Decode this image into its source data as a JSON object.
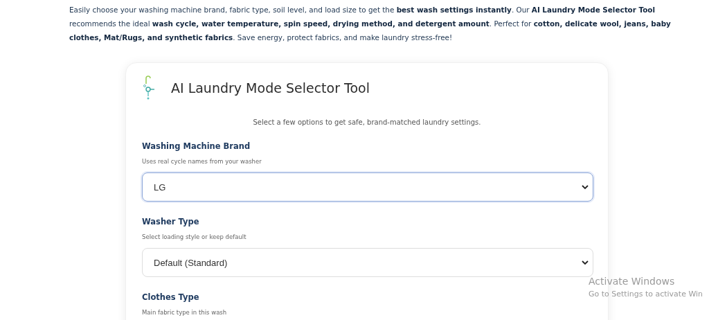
{
  "intro": "Easily choose your washing machine brand, fabric type, soil level, and load size to get the **best wash settings instantly**. Our **AI Laundry Mode Selector Tool** recommends the ideal **wash cycle, water temperature, spin speed, drying method, and detergent amount**. Perfect for **cotton, delicate wool, jeans, baby clothes, Mat/Rugs, and synthetic fabrics**. Save energy, protect fabrics, and make laundry stress-free!",
  "card": {
    "title": "AI Laundry Mode Selector Tool",
    "subtitle": "Select a few options to get safe, brand-matched laundry settings.",
    "fields": [
      {
        "label": "Washing Machine Brand",
        "hint": "Uses real cycle names from your washer",
        "value": "LG",
        "focused": true
      },
      {
        "label": "Washer Type",
        "hint": "Select loading style or keep default",
        "value": "Default (Standard)",
        "focused": false
      },
      {
        "label": "Clothes Type",
        "hint": "Main fabric type in this wash"
      }
    ]
  },
  "os_notice": {
    "title": "Activate Windows",
    "text": "Go to Settings to activate Win"
  }
}
